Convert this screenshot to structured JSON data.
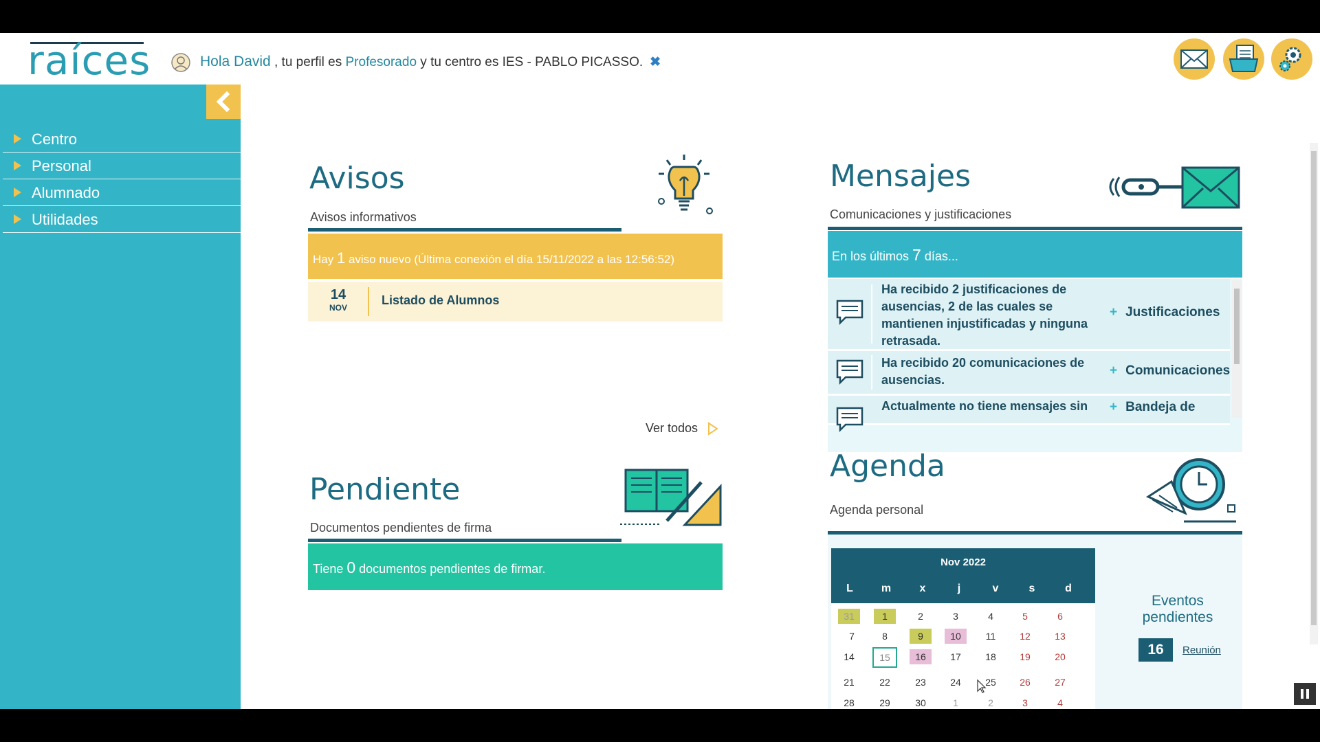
{
  "header": {
    "logo": "raíces",
    "greeting_hello": "Hola David",
    "greeting_profile_prefix": " , tu perfil es ",
    "profile": "Profesorado",
    "greeting_center_prefix": " y tu centro es ",
    "center": "IES - PABLO PICASSO.",
    "close_glyph": "✖",
    "buttons": [
      "envelope-icon",
      "documents-icon",
      "settings-gear-icon"
    ]
  },
  "sidebar": {
    "collapse_glyph": "‹",
    "items": [
      {
        "label": "Centro"
      },
      {
        "label": "Personal"
      },
      {
        "label": "Alumnado"
      },
      {
        "label": "Utilidades"
      }
    ]
  },
  "avisos": {
    "title": "Avisos",
    "subtitle": "Avisos informativos",
    "notice_prefix": "Hay ",
    "notice_count": "1",
    "notice_suffix": " aviso nuevo (Última conexión el día 15/11/2022 a las 12:56:52)",
    "item": {
      "day": "14",
      "month": "NOV",
      "title": "Listado de Alumnos"
    },
    "see_all": "Ver todos"
  },
  "pendiente": {
    "title": "Pendiente",
    "subtitle": "Documentos pendientes de firma",
    "text_prefix": "Tiene ",
    "count": "0",
    "text_suffix": " documentos pendientes de firmar."
  },
  "mensajes": {
    "title": "Mensajes",
    "subtitle": "Comunicaciones y justificaciones",
    "period_prefix": "En los últimos ",
    "period_days": "7",
    "period_suffix": " días...",
    "rows": [
      {
        "text": "Ha recibido 2 justificaciones de ausencias, 2 de las cuales se mantienen injustificadas y ninguna retrasada.",
        "link": "Justificaciones"
      },
      {
        "text": "Ha recibido 20 comunicaciones de ausencias.",
        "link": "Comunicaciones"
      },
      {
        "text": "Actualmente no tiene mensajes sin",
        "link": "Bandeja de"
      }
    ]
  },
  "agenda": {
    "title": "Agenda",
    "subtitle": "Agenda personal",
    "calendar": {
      "month": "Nov 2022",
      "dow": [
        "L",
        "m",
        "x",
        "j",
        "v",
        "s",
        "d"
      ],
      "weeks": [
        [
          "31",
          "1",
          "2",
          "3",
          "4",
          "5",
          "6"
        ],
        [
          "7",
          "8",
          "9",
          "10",
          "11",
          "12",
          "13"
        ],
        [
          "14",
          "15",
          "16",
          "17",
          "18",
          "19",
          "20"
        ],
        [
          "21",
          "22",
          "23",
          "24",
          "25",
          "26",
          "27"
        ],
        [
          "28",
          "29",
          "30",
          "1",
          "2",
          "3",
          "4"
        ]
      ]
    },
    "events_title": "Eventos pendientes",
    "event_day": "16",
    "event_label": "Reunión"
  },
  "colors": {
    "teal": "#34b5c7",
    "dark_teal": "#1b5e74",
    "yellow": "#f2c24f",
    "green": "#23c4a2"
  }
}
